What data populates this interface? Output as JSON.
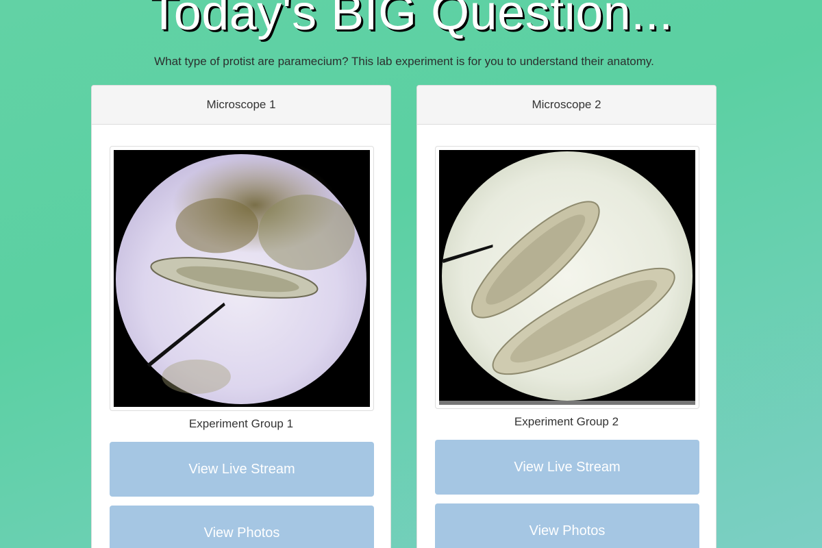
{
  "header": {
    "title": "Today's BIG Question...",
    "subtitle": "What type of protist are paramecium? This lab experiment is for you to understand their anatomy."
  },
  "cards": [
    {
      "header": "Microscope 1",
      "image_icon": "microscope-image",
      "group_label": "Experiment Group 1",
      "live_button": "View Live Stream",
      "photos_button": "View Photos"
    },
    {
      "header": "Microscope 2",
      "image_icon": "microscope-image",
      "group_label": "Experiment Group 2",
      "live_button": "View Live Stream",
      "photos_button": "View Photos"
    }
  ],
  "colors": {
    "background_start": "#62d2a5",
    "background_end": "#7ccfc4",
    "button": "#a5c6e3",
    "card_header": "#f5f5f5"
  }
}
